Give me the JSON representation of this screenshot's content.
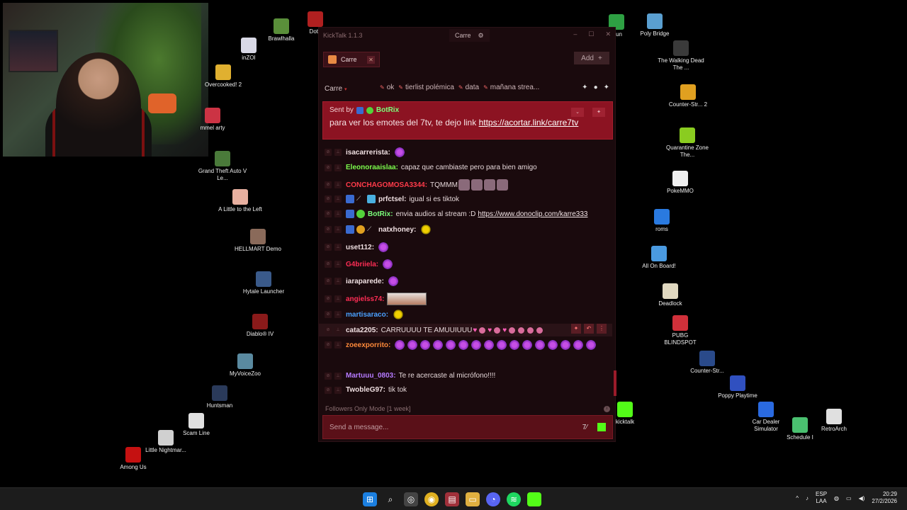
{
  "desktop_icons": [
    {
      "label": "Brawlhalla",
      "color": "#5a8f3a"
    },
    {
      "label": "Dota",
      "color": "#b02020"
    },
    {
      "label": "inZOI",
      "color": "#d9d9e6"
    },
    {
      "label": "Overcooked! 2",
      "color": "#e0b030"
    },
    {
      "label": "mmel arty",
      "color": "#cc3344"
    },
    {
      "label": "Grand Theft Auto V Le...",
      "color": "#4a7a3a"
    },
    {
      "label": "A Little to the Left",
      "color": "#e8b0a0"
    },
    {
      "label": "HELLMART Demo",
      "color": "#8a6a5a"
    },
    {
      "label": "Hytale Launcher",
      "color": "#3a5a8a"
    },
    {
      "label": "Diablo® IV",
      "color": "#8a1a1a"
    },
    {
      "label": "MyVoiceZoo",
      "color": "#5a8aa0"
    },
    {
      "label": "Huntsman",
      "color": "#2a3a5a"
    },
    {
      "label": "Scam Line",
      "color": "#e0e0e0"
    },
    {
      "label": "Little Nightmar...",
      "color": "#d0d0d0"
    },
    {
      "label": "Among Us",
      "color": "#c51111"
    },
    {
      "label": "drun",
      "color": "#2ea043"
    },
    {
      "label": "Poly Bridge",
      "color": "#5a9fd0"
    },
    {
      "label": "The Walking Dead The ...",
      "color": "#3a3a3a"
    },
    {
      "label": "Counter-Str... 2",
      "color": "#e0a020"
    },
    {
      "label": "Quarantine Zone The...",
      "color": "#8acc20"
    },
    {
      "label": "PokeMMO",
      "color": "#f0f0f0"
    },
    {
      "label": "roms",
      "color": "#2a7ae0"
    },
    {
      "label": "All On Board!",
      "color": "#4a9ae0"
    },
    {
      "label": "Deadlock",
      "color": "#e0d8c0"
    },
    {
      "label": "PUBG BLINDSPOT",
      "color": "#d0303a"
    },
    {
      "label": "Counter-Str...",
      "color": "#2a4a8a"
    },
    {
      "label": "Poppy Playtime",
      "color": "#3050c0"
    },
    {
      "label": "Car Dealer Simulator",
      "color": "#2a6ae0"
    },
    {
      "label": "Schedule I",
      "color": "#4ac070"
    },
    {
      "label": "RetroArch",
      "color": "#e0e0e0"
    },
    {
      "label": "kicktalk",
      "color": "#53fc18"
    }
  ],
  "window": {
    "title": "KickTalk 1.1.3",
    "channel_chip": "Carre",
    "gear": "⚙",
    "min": "–",
    "max": "☐",
    "close": "✕"
  },
  "tabs": [
    {
      "label": "Carre",
      "close": "✕"
    }
  ],
  "add_button": {
    "label": "Add",
    "icon": "+"
  },
  "channel_bar": {
    "name": "Carre",
    "caret": "▾",
    "pinned_tags": [
      "ok",
      "tierlist polémica",
      "data",
      "mañana strea..."
    ]
  },
  "pinned_message": {
    "sent_by_label": "Sent by",
    "user": "BotRix",
    "text": "para ver los emotes del 7tv, te dejo link ",
    "link": "https://acortar.link/carre7tv",
    "collapse_icon": "⌄",
    "unpin_icon": "✦"
  },
  "messages": [
    {
      "user": "isacarrerista:",
      "color": "#f0e0e2",
      "text": "",
      "emotes": 1
    },
    {
      "user": "Eleonoraaislaa:",
      "color": "#7cfc4c",
      "text": "capaz que cambiaste pero para bien amigo"
    },
    {
      "user": "CONCHAGOMOSA3344:",
      "color": "#ff3b4a",
      "text": "TQMMM"
    },
    {
      "user": "prfctsel:",
      "color": "#f0e0e2",
      "text": "igual si es tiktok"
    },
    {
      "user": "BotRix:",
      "color": "#7bff7b",
      "text": "envia audios al stream :D ",
      "link": "https://www.donoclip.com/karre333"
    },
    {
      "user": "natxhoney:",
      "color": "#f0e0e2",
      "text": ""
    },
    {
      "user": "uset112:",
      "color": "#f0e0e2",
      "text": ""
    },
    {
      "user": "G4briiela:",
      "color": "#ff2d55",
      "text": ""
    },
    {
      "user": "iaraparede:",
      "color": "#f0e0e2",
      "text": ""
    },
    {
      "user": "angielss74:",
      "color": "#ff2d55",
      "text": ""
    },
    {
      "user": "martisaraco:",
      "color": "#4aa0ff",
      "text": ""
    },
    {
      "user": "cata2205:",
      "color": "#f0e0e2",
      "text": "CARRUUUU TE AMUUIUUU"
    },
    {
      "user": "zoeexporrito:",
      "color": "#ff8a3a",
      "text": ""
    },
    {
      "user": "Martuuu_0803:",
      "color": "#b67bff",
      "text": "Te re acercaste al micrófono!!!!"
    },
    {
      "user": "TwobleG97:",
      "color": "#f0e0e2",
      "text": "tik tok"
    }
  ],
  "followers_mode": "Followers Only Mode [1 week]",
  "input": {
    "placeholder": "Send a message..."
  },
  "taskbar": {
    "lang_line1": "ESP",
    "lang_line2": "LAA",
    "time": "20:29",
    "date": "27/2/2026",
    "caret": "^"
  }
}
